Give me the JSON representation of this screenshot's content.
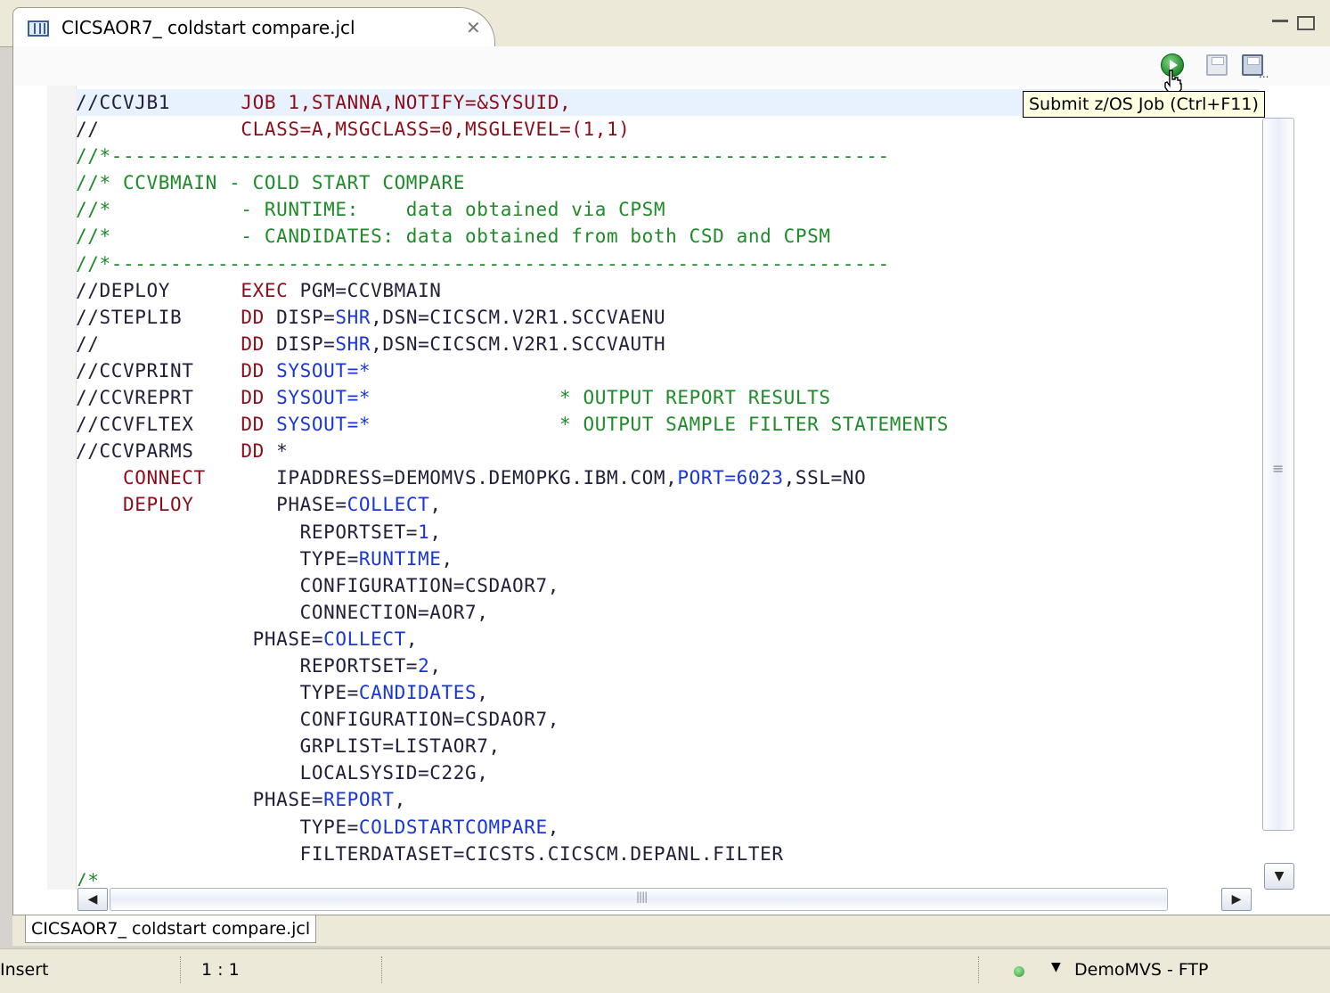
{
  "editor_tab": {
    "label": "CICSAOR7_ coldstart compare.jcl"
  },
  "toolbar": {
    "tooltip": "Submit z/OS Job (Ctrl+F11)"
  },
  "code_lines": [
    [
      {
        "t": "//CCVJB1      ",
        "c": "t"
      },
      {
        "t": "JOB 1,STANNA,NOTIFY=&SYSUID,",
        "c": "k"
      }
    ],
    [
      {
        "t": "//            ",
        "c": "t"
      },
      {
        "t": "CLASS=A,MSGCLASS=0,MSGLEVEL=(1,1)",
        "c": "k"
      }
    ],
    [
      {
        "t": "//*------------------------------------------------------------------",
        "c": "c"
      }
    ],
    [
      {
        "t": "//* CCVBMAIN - COLD START COMPARE",
        "c": "c"
      }
    ],
    [
      {
        "t": "//*           - RUNTIME:    data obtained via CPSM",
        "c": "c"
      }
    ],
    [
      {
        "t": "//*           - CANDIDATES: data obtained from both CSD and CPSM",
        "c": "c"
      }
    ],
    [
      {
        "t": "//*------------------------------------------------------------------",
        "c": "c"
      }
    ],
    [
      {
        "t": "//DEPLOY      ",
        "c": "t"
      },
      {
        "t": "EXEC",
        "c": "k"
      },
      {
        "t": " PGM=CCVBMAIN",
        "c": "t"
      }
    ],
    [
      {
        "t": "//STEPLIB     ",
        "c": "t"
      },
      {
        "t": "DD",
        "c": "k"
      },
      {
        "t": " DISP=",
        "c": "t"
      },
      {
        "t": "SHR",
        "c": "v"
      },
      {
        "t": ",DSN=CICSCM.V2R1.SCCVAENU",
        "c": "t"
      }
    ],
    [
      {
        "t": "//            ",
        "c": "t"
      },
      {
        "t": "DD",
        "c": "k"
      },
      {
        "t": " DISP=",
        "c": "t"
      },
      {
        "t": "SHR",
        "c": "v"
      },
      {
        "t": ",DSN=CICSCM.V2R1.SCCVAUTH",
        "c": "t"
      }
    ],
    [
      {
        "t": "//CCVPRINT    ",
        "c": "t"
      },
      {
        "t": "DD",
        "c": "k"
      },
      {
        "t": " SYSOUT=*",
        "c": "v"
      }
    ],
    [
      {
        "t": "//CCVREPRT    ",
        "c": "t"
      },
      {
        "t": "DD",
        "c": "k"
      },
      {
        "t": " SYSOUT=*",
        "c": "v"
      },
      {
        "t": "                * OUTPUT REPORT RESULTS",
        "c": "c"
      }
    ],
    [
      {
        "t": "//CCVFLTEX    ",
        "c": "t"
      },
      {
        "t": "DD",
        "c": "k"
      },
      {
        "t": " SYSOUT=*",
        "c": "v"
      },
      {
        "t": "                * OUTPUT SAMPLE FILTER STATEMENTS",
        "c": "c"
      }
    ],
    [
      {
        "t": "//CCVPARMS    ",
        "c": "t"
      },
      {
        "t": "DD",
        "c": "k"
      },
      {
        "t": " *",
        "c": "t"
      }
    ],
    [
      {
        "t": "    ",
        "c": "t"
      },
      {
        "t": "CONNECT",
        "c": "k"
      },
      {
        "t": "      IPADDRESS=DEMOMVS.DEMOPKG.IBM.COM,",
        "c": "t"
      },
      {
        "t": "PORT=6023",
        "c": "v"
      },
      {
        "t": ",SSL=NO",
        "c": "t"
      }
    ],
    [
      {
        "t": "    ",
        "c": "t"
      },
      {
        "t": "DEPLOY",
        "c": "k"
      },
      {
        "t": "       PHASE=",
        "c": "t"
      },
      {
        "t": "COLLECT",
        "c": "v"
      },
      {
        "t": ",",
        "c": "t"
      }
    ],
    [
      {
        "t": "                   REPORTSET=",
        "c": "t"
      },
      {
        "t": "1",
        "c": "v"
      },
      {
        "t": ",",
        "c": "t"
      }
    ],
    [
      {
        "t": "                   TYPE=",
        "c": "t"
      },
      {
        "t": "RUNTIME",
        "c": "v"
      },
      {
        "t": ",",
        "c": "t"
      }
    ],
    [
      {
        "t": "                   CONFIGURATION=CSDAOR7,",
        "c": "t"
      }
    ],
    [
      {
        "t": "                   CONNECTION=AOR7,",
        "c": "t"
      }
    ],
    [
      {
        "t": "               PHASE=",
        "c": "t"
      },
      {
        "t": "COLLECT",
        "c": "v"
      },
      {
        "t": ",",
        "c": "t"
      }
    ],
    [
      {
        "t": "                   REPORTSET=",
        "c": "t"
      },
      {
        "t": "2",
        "c": "v"
      },
      {
        "t": ",",
        "c": "t"
      }
    ],
    [
      {
        "t": "                   TYPE=",
        "c": "t"
      },
      {
        "t": "CANDIDATES",
        "c": "v"
      },
      {
        "t": ",",
        "c": "t"
      }
    ],
    [
      {
        "t": "                   CONFIGURATION=CSDAOR7,",
        "c": "t"
      }
    ],
    [
      {
        "t": "                   GRPLIST=LISTAOR7,",
        "c": "t"
      }
    ],
    [
      {
        "t": "                   LOCALSYSID=C22G,",
        "c": "t"
      }
    ],
    [
      {
        "t": "               PHASE=",
        "c": "t"
      },
      {
        "t": "REPORT",
        "c": "v"
      },
      {
        "t": ",",
        "c": "t"
      }
    ],
    [
      {
        "t": "                   TYPE=",
        "c": "t"
      },
      {
        "t": "COLDSTARTCOMPARE",
        "c": "v"
      },
      {
        "t": ",",
        "c": "t"
      }
    ],
    [
      {
        "t": "                   FILTERDATASET=CICSTS.CICSCM.DEPANL.FILTER",
        "c": "t"
      }
    ],
    [
      {
        "t": "/*",
        "c": "c"
      }
    ]
  ],
  "statusbar": {
    "mode": "Insert",
    "position": "1 : 1",
    "connection": "DemoMVS - FTP",
    "connection_status_color": "#2c9a3a"
  },
  "colors": {
    "keyword": "#8b0d1a",
    "value": "#1a36d6",
    "comment": "#1f8a2a"
  }
}
